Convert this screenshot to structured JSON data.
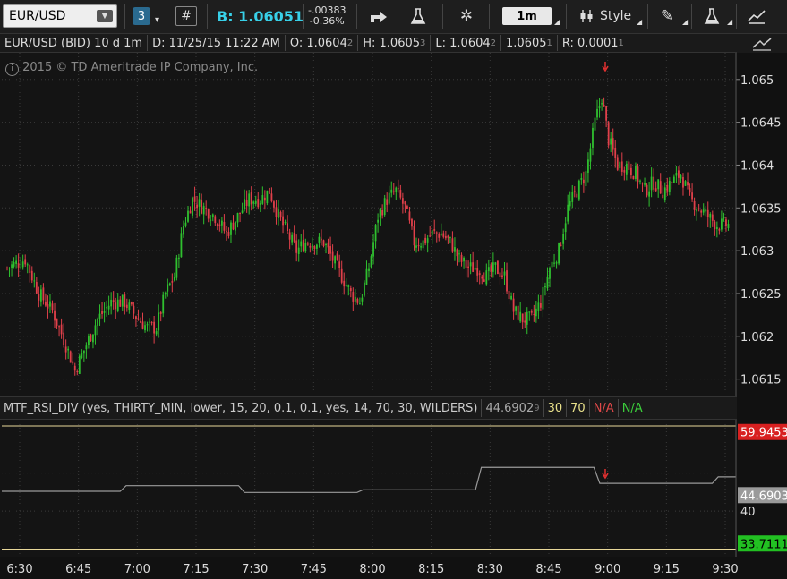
{
  "toolbar": {
    "symbol": "EUR/USD",
    "link_group": "3",
    "hash_icon": "#",
    "bid": "B: 1.06051",
    "change": "-.00383",
    "change_pct": "-0.36%",
    "timeframe": "1m",
    "style_label": "Style"
  },
  "header": {
    "title": "EUR/USD (BID) 10 d 1m",
    "date": "D: 11/25/15 11:22 AM",
    "open": "O: 1.0604",
    "open_last": "2",
    "high": "H: 1.0605",
    "high_last": "3",
    "low": "L: 1.0604",
    "low_last": "2",
    "close": "1.0605",
    "close_last": "1",
    "range": "R: 0.0001",
    "range_last": "1"
  },
  "copyright": "2015 © TD Ameritrade IP Company, Inc.",
  "study": {
    "name": "MTF_RSI_DIV (yes, THIRTY_MIN, lower, 15, 20, 0.1, 0.1, yes, 14, 70, 30, WILDERS)",
    "value": "44.6902",
    "value_last": "9",
    "oversold": "30",
    "overbought": "70",
    "na1": "N/A",
    "na2": "N/A"
  },
  "study_axis": {
    "upper_value": "59.9453",
    "current_value": "44.6903",
    "level_40": "40",
    "lower_value": "33.7111"
  },
  "colors": {
    "up": "#2fc02f",
    "down": "#e0404a",
    "accent": "#2d9bd6",
    "line_yellow": "#e8d89a",
    "arrow": "#e03030"
  },
  "chart_data": {
    "type": "candlestick",
    "price_axis_ticks": [
      "1.065",
      "1.0645",
      "1.064",
      "1.0635",
      "1.063",
      "1.0625",
      "1.062",
      "1.0615"
    ],
    "time_axis_ticks": [
      "6:30",
      "6:45",
      "7:00",
      "7:15",
      "7:30",
      "7:45",
      "8:00",
      "8:15",
      "8:30",
      "8:45",
      "9:00",
      "9:15",
      "9:30"
    ],
    "ylim": [
      1.06135,
      1.06528
    ],
    "close_path": [
      [
        0,
        1.0628
      ],
      [
        8,
        1.0629
      ],
      [
        14,
        1.0625
      ],
      [
        20,
        1.0623
      ],
      [
        26,
        1.0619
      ],
      [
        30,
        1.0616
      ],
      [
        35,
        1.0619
      ],
      [
        40,
        1.0622
      ],
      [
        46,
        1.0624
      ],
      [
        52,
        1.0624
      ],
      [
        58,
        1.0622
      ],
      [
        62,
        1.0621
      ],
      [
        66,
        1.0621
      ],
      [
        70,
        1.0625
      ],
      [
        74,
        1.0627
      ],
      [
        78,
        1.0633
      ],
      [
        82,
        1.0636
      ],
      [
        87,
        1.0635
      ],
      [
        92,
        1.0634
      ],
      [
        97,
        1.0632
      ],
      [
        102,
        1.0634
      ],
      [
        107,
        1.0636
      ],
      [
        112,
        1.0636
      ],
      [
        116,
        1.0637
      ],
      [
        120,
        1.0634
      ],
      [
        124,
        1.0632
      ],
      [
        128,
        1.063
      ],
      [
        132,
        1.0631
      ],
      [
        136,
        1.0631
      ],
      [
        140,
        1.0631
      ],
      [
        144,
        1.0629
      ],
      [
        148,
        1.0627
      ],
      [
        152,
        1.0625
      ],
      [
        156,
        1.0624
      ],
      [
        160,
        1.0628
      ],
      [
        164,
        1.0634
      ],
      [
        168,
        1.0636
      ],
      [
        172,
        1.0637
      ],
      [
        176,
        1.0635
      ],
      [
        180,
        1.0631
      ],
      [
        184,
        1.0631
      ],
      [
        188,
        1.0632
      ],
      [
        192,
        1.0632
      ],
      [
        196,
        1.0631
      ],
      [
        200,
        1.0629
      ],
      [
        204,
        1.0628
      ],
      [
        208,
        1.0628
      ],
      [
        212,
        1.0627
      ],
      [
        216,
        1.0628
      ],
      [
        220,
        1.0627
      ],
      [
        224,
        1.0623
      ],
      [
        228,
        1.0622
      ],
      [
        232,
        1.0622
      ],
      [
        236,
        1.0624
      ],
      [
        240,
        1.0628
      ],
      [
        244,
        1.063
      ],
      [
        248,
        1.0635
      ],
      [
        252,
        1.0637
      ],
      [
        256,
        1.0639
      ],
      [
        260,
        1.0645
      ],
      [
        263,
        1.0648
      ],
      [
        266,
        1.0643
      ],
      [
        270,
        1.064
      ],
      [
        274,
        1.064
      ],
      [
        278,
        1.0639
      ],
      [
        282,
        1.0637
      ],
      [
        286,
        1.0638
      ],
      [
        290,
        1.0637
      ],
      [
        294,
        1.0638
      ],
      [
        298,
        1.0639
      ],
      [
        302,
        1.0636
      ],
      [
        306,
        1.0635
      ],
      [
        310,
        1.0634
      ],
      [
        314,
        1.0633
      ],
      [
        318,
        1.0633
      ]
    ],
    "study_steps": [
      [
        0,
        45.2
      ],
      [
        20,
        45.2
      ],
      [
        21,
        46.7
      ],
      [
        40,
        46.7
      ],
      [
        41,
        44.9
      ],
      [
        60,
        44.9
      ],
      [
        61,
        45.6
      ],
      [
        80,
        45.6
      ],
      [
        81,
        51.5
      ],
      [
        100,
        51.5
      ],
      [
        101,
        47.3
      ],
      [
        120,
        47.3
      ],
      [
        121,
        49.0
      ],
      [
        124,
        49.0
      ]
    ],
    "study_ylim": [
      28.5,
      63.8
    ],
    "study_ref_lines": [
      62.4,
      29.8
    ]
  }
}
